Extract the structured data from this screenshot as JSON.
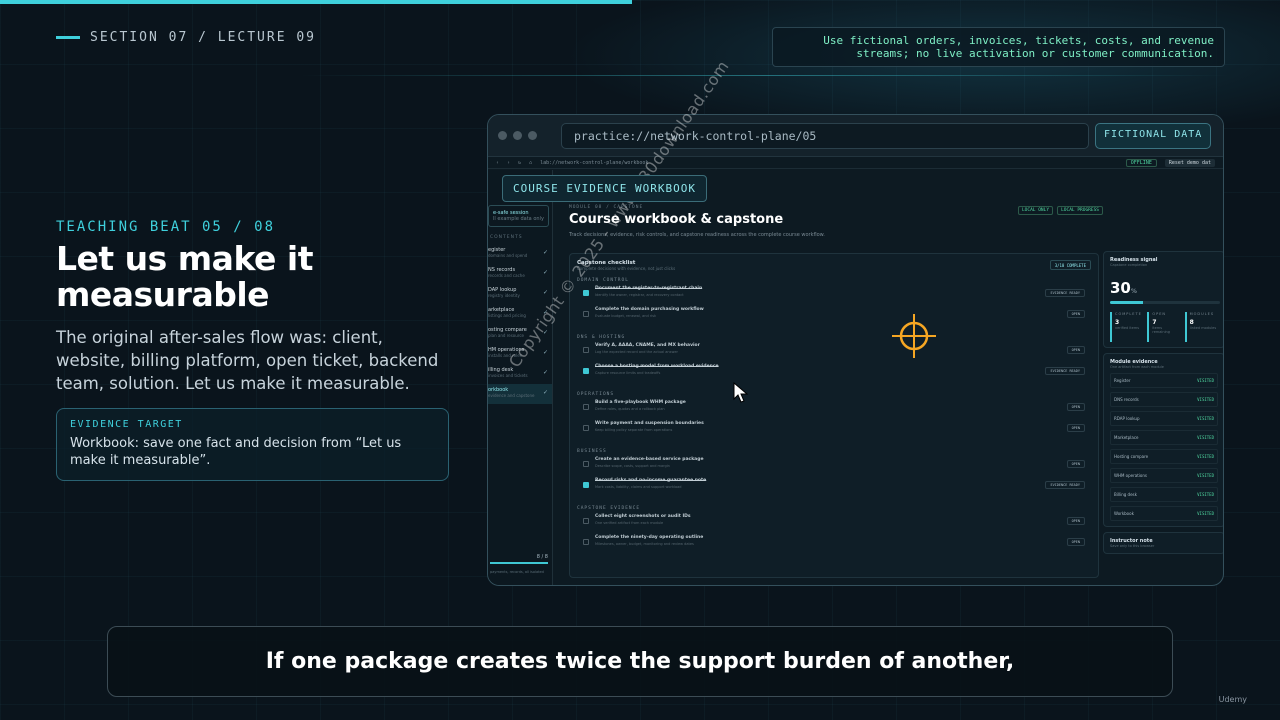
{
  "header": {
    "section_label": "SECTION 07 / LECTURE 09",
    "notice": "Use fictional orders, invoices, tickets, costs, and revenue streams; no live activation or customer communication."
  },
  "slide": {
    "beat": "TEACHING BEAT 05 / 08",
    "headline": "Let us make it measurable",
    "lead": "The original after-sales flow was: client, website, billing platform, open ticket, backend team, solution. Let us make it measurable.",
    "evidence": {
      "label": "EVIDENCE TARGET",
      "text": "Workbook: save one fact and decision from “Let us make it measurable”."
    }
  },
  "browser": {
    "url": "practice://network-control-plane/05",
    "fictional_badge": "FICTIONAL DATA",
    "inner_url": "lab://network-control-plane/workbook",
    "offline_chip": "OFFLINE",
    "reset_button": "Reset demo dat",
    "ready_text": "Ready for guided session",
    "workbook_tag": "COURSE EVIDENCE WORKBOOK"
  },
  "sidebar": {
    "session_title": "e-safe session",
    "session_sub": "ll example data only",
    "section": "CONTENTS",
    "items": [
      {
        "label": "egister",
        "sub": "domains and spend"
      },
      {
        "label": "NS records",
        "sub": "records and cache"
      },
      {
        "label": "DAP lookup",
        "sub": "registry identity"
      },
      {
        "label": "arketplace",
        "sub": "listings and pricing"
      },
      {
        "label": "osting compare",
        "sub": "plan and resource"
      },
      {
        "label": "HM operations",
        "sub": "installs and roles"
      },
      {
        "label": "illing desk",
        "sub": "invoices and tickets"
      },
      {
        "label": "orkbook",
        "sub": "evidence and capstone"
      }
    ],
    "pager": "8 / 8",
    "footer": "payments, records, all isolated"
  },
  "main": {
    "crumb": "MODULE 08 / CAPSTONE",
    "title": "Course workbook & capstone",
    "subtitle": "Track decisions, evidence, risk controls, and capstone readiness across the complete course workflow.",
    "chip_local": "LOCAL ONLY",
    "chip_progress": "LOCAL PROGRESS",
    "checklist": {
      "title": "Capstone checklist",
      "subtitle": "Complete decisions with evidence, not just clicks",
      "done_badge": "3/10 COMPLETE",
      "groups": [
        {
          "name": "DOMAIN CONTROL",
          "rows": [
            {
              "title": "Document the register-to-registrant chain",
              "sub": "Identify the owner, registrar, and recovery contact",
              "done": true,
              "btn": "EVIDENCE READY"
            },
            {
              "title": "Complete the domain purchasing workflow",
              "sub": "Evaluate budget, renewal, and risk",
              "done": false,
              "btn": "OPEN"
            }
          ]
        },
        {
          "name": "DNS & HOSTING",
          "rows": [
            {
              "title": "Verify A, AAAA, CNAME, and MX behavior",
              "sub": "Log the expected record and the actual answer",
              "done": false,
              "btn": "OPEN"
            },
            {
              "title": "Choose a hosting model from workload evidence",
              "sub": "Capture resource limits and tradeoffs",
              "done": true,
              "btn": "EVIDENCE READY"
            }
          ]
        },
        {
          "name": "OPERATIONS",
          "rows": [
            {
              "title": "Build a five-playbook WHM package",
              "sub": "Define roles, quotas and a rollback plan",
              "done": false,
              "btn": "OPEN"
            },
            {
              "title": "Write payment and suspension boundaries",
              "sub": "Keep billing policy separate from operations",
              "done": false,
              "btn": "OPEN"
            }
          ]
        },
        {
          "name": "BUSINESS",
          "rows": [
            {
              "title": "Create an evidence-based service package",
              "sub": "Describe scope, costs, support and margin",
              "done": false,
              "btn": "OPEN"
            },
            {
              "title": "Record risks and no-income guarantee note",
              "sub": "Mark costs, liability, claims and support workload",
              "done": true,
              "btn": "EVIDENCE READY"
            }
          ]
        },
        {
          "name": "CAPSTONE EVIDENCE",
          "rows": [
            {
              "title": "Collect eight screenshots or audit IDs",
              "sub": "One verified artifact from each module",
              "done": false,
              "btn": "OPEN"
            },
            {
              "title": "Complete the ninety-day operating outline",
              "sub": "Milestones, owner, budget, monitoring and review dates",
              "done": false,
              "btn": "OPEN"
            }
          ]
        }
      ]
    }
  },
  "readiness": {
    "title": "Readiness signal",
    "sub": "Capstone completion",
    "score": "30",
    "score_unit": "%",
    "fill_percent": 30,
    "stats": [
      {
        "k": "COMPLETE",
        "v": "3",
        "s": "verified items"
      },
      {
        "k": "OPEN",
        "v": "7",
        "s": "items remaining"
      },
      {
        "k": "MODULES",
        "v": "8",
        "s": "linked modules"
      }
    ]
  },
  "module_evidence": {
    "title": "Module evidence",
    "sub": "One artifact from each module",
    "rows": [
      {
        "name": "Register",
        "status": "VISITED"
      },
      {
        "name": "DNS records",
        "status": "VISITED"
      },
      {
        "name": "RDAP lookup",
        "status": "VISITED"
      },
      {
        "name": "Marketplace",
        "status": "VISITED"
      },
      {
        "name": "Hosting compare",
        "status": "VISITED"
      },
      {
        "name": "WHM operations",
        "status": "VISITED"
      },
      {
        "name": "Billing desk",
        "status": "VISITED"
      },
      {
        "name": "Workbook",
        "status": "VISITED"
      }
    ]
  },
  "instructor": {
    "title": "Instructor note",
    "sub": "Save only to this browser"
  },
  "watermark": "Copyright © 2025 - www.p30download.com",
  "caption": "If one package creates twice the support burden of another,",
  "brand": "Udemy",
  "colors": {
    "accent": "#3fd0dc",
    "success": "#4fd6a0",
    "crosshair": "#f5a623"
  }
}
